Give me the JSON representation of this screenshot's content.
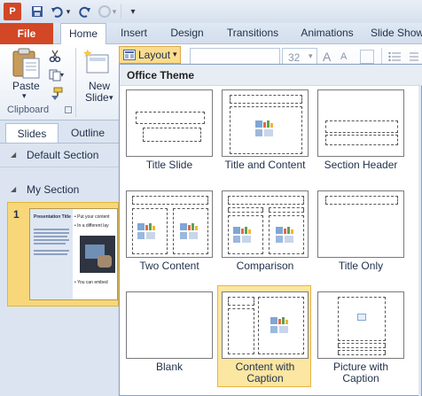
{
  "app": {
    "logo_letter": "P"
  },
  "qat": {
    "undo_arrow": "▾",
    "customize": "▾"
  },
  "tabs": [
    "File",
    "Home",
    "Insert",
    "Design",
    "Transitions",
    "Animations",
    "Slide Show"
  ],
  "ribbon": {
    "paste_label": "Paste",
    "paste_arrow": "▾",
    "new_slide_label_1": "New",
    "new_slide_label_2": "Slide",
    "new_slide_arrow": "▾",
    "layout_label": "Layout",
    "layout_arrow": "▾",
    "clipboard_group": "Clipboard",
    "font_size": "32",
    "font_size_arrow": "▾"
  },
  "leftpane": {
    "tabs": [
      "Slides",
      "Outline"
    ],
    "sections": [
      {
        "label": "Default Section"
      },
      {
        "label": "My Section"
      }
    ],
    "slide": {
      "number": "1",
      "title": "Presentation Title",
      "bullets": [
        "Put your content",
        "In a different lay",
        "You can embed"
      ]
    }
  },
  "layout_menu": {
    "header": "Office Theme",
    "items": [
      {
        "label": "Title Slide"
      },
      {
        "label": "Title and Content"
      },
      {
        "label": "Section Header"
      },
      {
        "label": "Two Content"
      },
      {
        "label": "Comparison"
      },
      {
        "label": "Title Only"
      },
      {
        "label": "Blank"
      },
      {
        "label": "Content with Caption"
      },
      {
        "label": "Picture with Caption"
      }
    ]
  },
  "colors": {
    "accent_file": "#d24726",
    "selected_item": "#fbe6a2",
    "selected_border": "#e8b544"
  }
}
